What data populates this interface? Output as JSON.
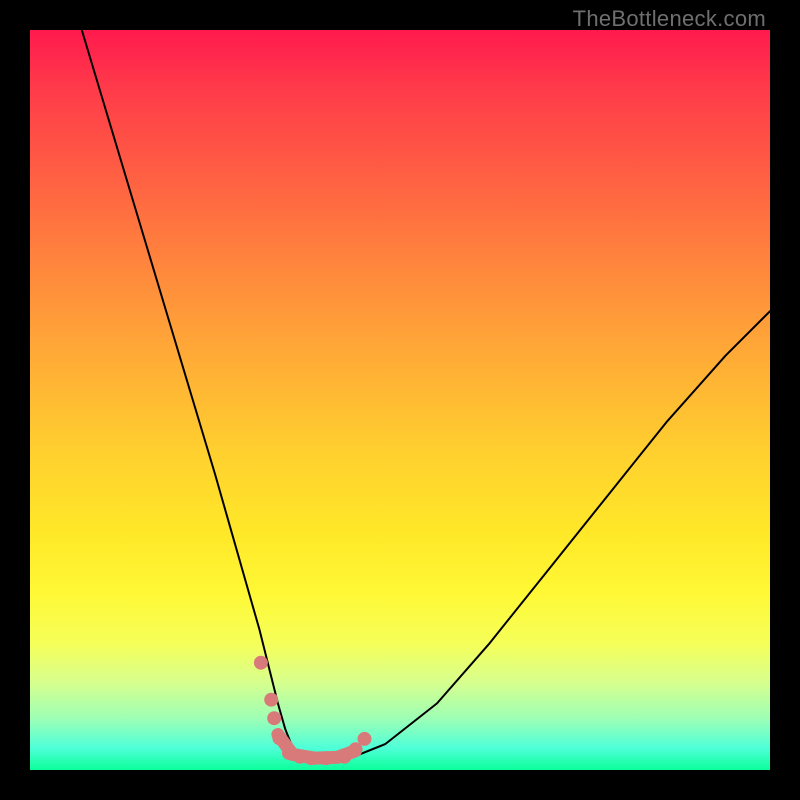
{
  "watermark": {
    "text": "TheBottleneck.com"
  },
  "chart_data": {
    "type": "line",
    "title": "",
    "xlabel": "",
    "ylabel": "",
    "xlim": [
      0,
      100
    ],
    "ylim": [
      0,
      100
    ],
    "grid": false,
    "legend": false,
    "background": "rainbow-gradient-red-to-green-vertical",
    "series": [
      {
        "name": "bottleneck-curve",
        "color": "#000000",
        "stroke_width": 2,
        "x": [
          7,
          10,
          13,
          16,
          19,
          22,
          25,
          27,
          29,
          31,
          32.5,
          33.5,
          34.5,
          35.5,
          37,
          39,
          43,
          48,
          55,
          62,
          70,
          78,
          86,
          94,
          100
        ],
        "y": [
          100,
          90,
          80,
          70,
          60,
          50,
          40,
          33,
          26,
          19,
          13,
          9,
          5.5,
          3,
          1.8,
          1.5,
          1.5,
          3.5,
          9,
          17,
          27,
          37,
          47,
          56,
          62
        ]
      },
      {
        "name": "fit-marker-dots",
        "color": "#d97a7a",
        "type": "scatter",
        "marker_radius": 7,
        "x": [
          31.2,
          32.6,
          33.0,
          33.7,
          35.0,
          36.5,
          38.0,
          40.0,
          42.5,
          44.0,
          45.2
        ],
        "y": [
          14.5,
          9.5,
          7.0,
          4.3,
          2.3,
          1.8,
          1.6,
          1.6,
          1.8,
          2.8,
          4.2
        ]
      },
      {
        "name": "fit-marker-line",
        "color": "#d97a7a",
        "stroke_width": 13,
        "x": [
          33.5,
          35.5,
          38.5,
          41.5,
          44.0
        ],
        "y": [
          4.8,
          2.1,
          1.6,
          1.7,
          2.6
        ]
      }
    ]
  }
}
